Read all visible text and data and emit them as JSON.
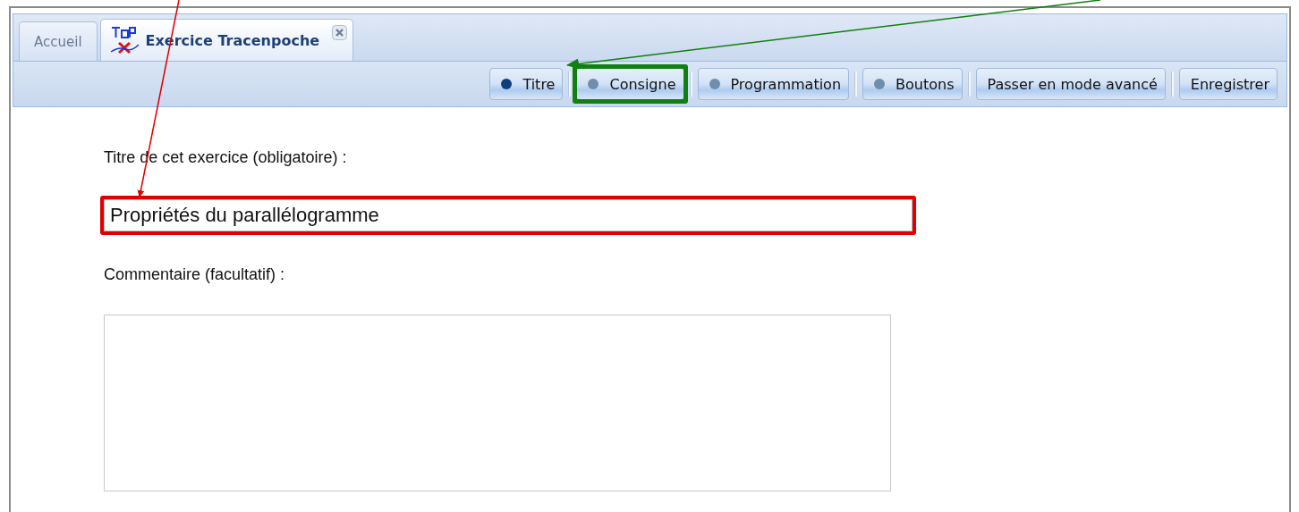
{
  "tabs": [
    {
      "label": "Accueil",
      "selected": false,
      "closable": false,
      "has_logo": false
    },
    {
      "label": "Exercice Tracenpoche",
      "selected": true,
      "closable": true,
      "has_logo": true
    }
  ],
  "toolbar": [
    {
      "label": "Titre",
      "kind": "section",
      "selected": true
    },
    {
      "label": "Consigne",
      "kind": "section",
      "selected": false,
      "color": "#108010"
    },
    {
      "label": "Programmation",
      "kind": "section",
      "selected": false
    },
    {
      "label": "Boutons",
      "kind": "section",
      "selected": false
    },
    {
      "label": "Passer en mode avancé",
      "kind": "action"
    },
    {
      "label": "Enregistrer",
      "kind": "action"
    }
  ],
  "form": {
    "title_label": "Titre de cet exercice (obligatoire) :",
    "title_field": {
      "value": "Propriétés du parallélogramme",
      "color": "#e00000"
    },
    "comment_label": "Commentaire (facultatif) :"
  }
}
